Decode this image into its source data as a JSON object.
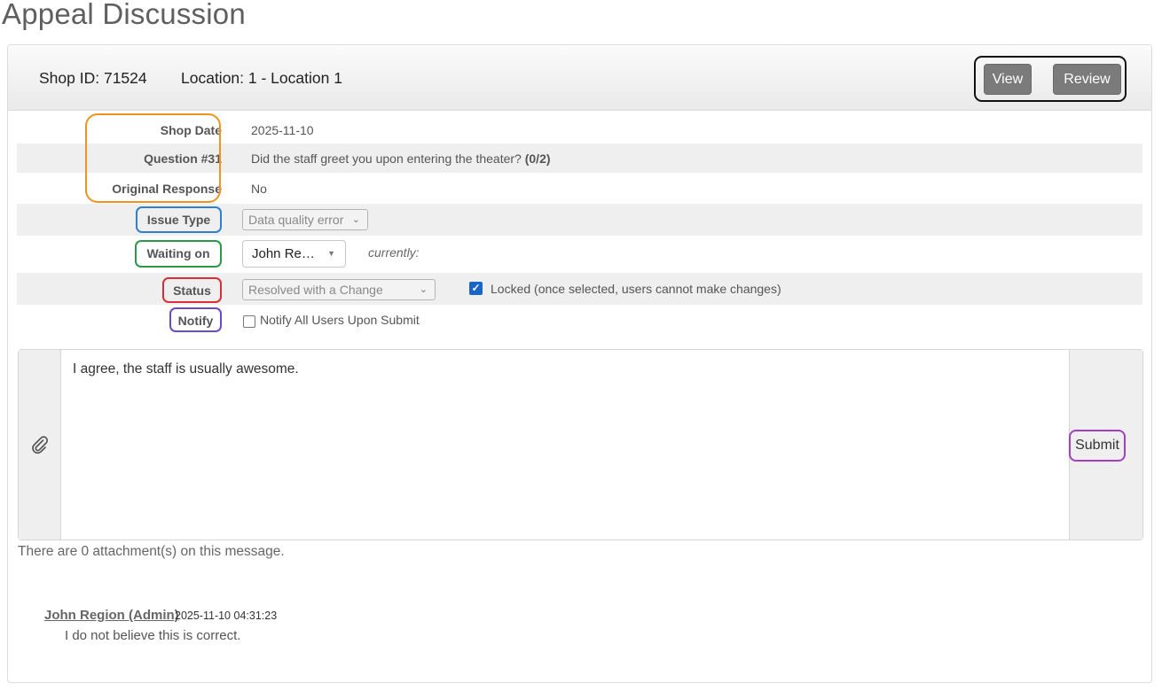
{
  "page": {
    "title": "Appeal Discussion"
  },
  "header": {
    "shop_id": "Shop ID: 71524",
    "location": "Location: 1 - Location 1",
    "view_label": "View",
    "review_label": "Review"
  },
  "fields": {
    "shop_date_label": "Shop Date",
    "shop_date_value": "2025-11-10",
    "question_label": "Question #31",
    "question_text": "Did the staff greet you upon entering the theater?",
    "question_score": "(0/2)",
    "original_response_label": "Original Response",
    "original_response_value": "No",
    "issue_type_label": "Issue Type",
    "issue_type_value": "Data quality error",
    "waiting_on_label": "Waiting on",
    "waiting_on_value": "John Re…",
    "currently_label": "currently:",
    "status_label": "Status",
    "status_value": "Resolved with a Change",
    "locked_label": "Locked (once selected, users cannot make changes)",
    "notify_label": "Notify",
    "notify_all_label": "Notify All Users Upon Submit"
  },
  "message": {
    "text": "I agree, the staff is usually awesome.",
    "submit_label": "Submit",
    "attachment_note": "There are 0 attachment(s) on this message."
  },
  "comments": [
    {
      "author": "John Region (Admin)",
      "timestamp": "2025-11-10 04:31:23",
      "body": "I do not believe this is correct."
    }
  ],
  "colors": {
    "orange_highlight": "#f0941d",
    "blue_highlight": "#2f7fd0",
    "green_highlight": "#2b9a46",
    "red_highlight": "#d62f3a",
    "indigo_highlight": "#6a4cc8",
    "purple_highlight": "#a33fc0",
    "button_gray": "#7b7b7b",
    "checkbox_blue": "#1a66c8"
  },
  "icons": {
    "attach": "paperclip-icon",
    "chevron": "chevron-down-icon",
    "checkbox": "checkmark-icon"
  }
}
